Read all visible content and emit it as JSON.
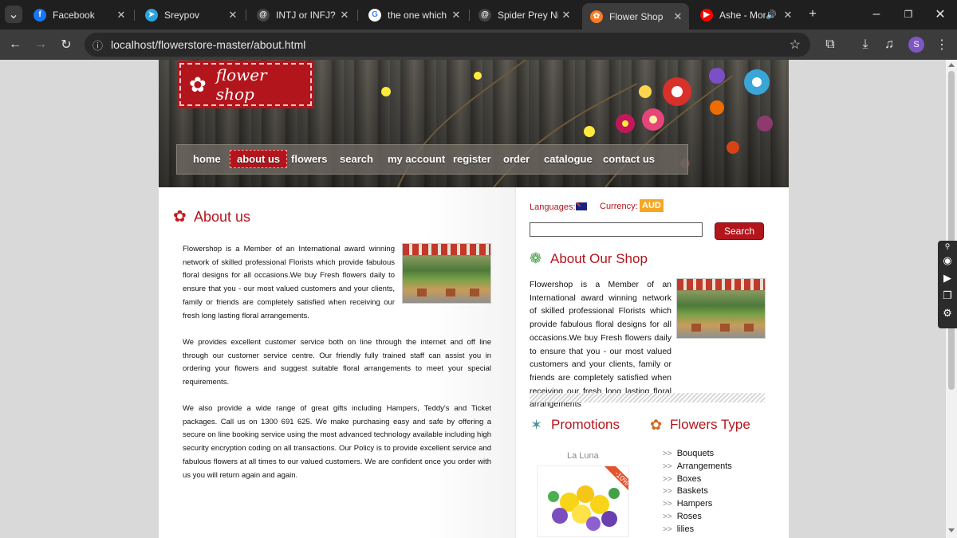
{
  "browser": {
    "tabs": [
      {
        "label": "Facebook",
        "icon": "facebook-icon",
        "color": "#1877f2",
        "glyph": "f",
        "active": false
      },
      {
        "label": "Sreypov",
        "icon": "telegram-icon",
        "color": "#2aa3df",
        "glyph": "➤",
        "active": false
      },
      {
        "label": "INTJ or INFJ?",
        "icon": "threads-icon",
        "color": "#444444",
        "glyph": "@",
        "active": false
      },
      {
        "label": "the one which co",
        "icon": "google-icon",
        "color": "#ffffff",
        "glyph": "G",
        "active": false
      },
      {
        "label": "Spider Prey Nick",
        "icon": "threads-icon",
        "color": "#444444",
        "glyph": "@",
        "active": false
      },
      {
        "label": "Flower Shop",
        "icon": "xampp-icon",
        "color": "#fb7a24",
        "glyph": "✿",
        "active": true
      },
      {
        "label": "Ashe - Mora",
        "icon": "youtube-icon",
        "color": "#ff0000",
        "glyph": "▶",
        "active": false
      }
    ],
    "url": "localhost/flowerstore-master/about.html",
    "profile_initial": "S"
  },
  "site": {
    "logo_text": "flower shop",
    "menu": [
      "home",
      "about us",
      "flowers",
      "search",
      "my account",
      "register",
      "order",
      "catalogue",
      "contact us"
    ],
    "active_menu": "about us",
    "about": {
      "title": "About us",
      "p1": "Flowershop is a Member of an International award winning network of skilled professional Florists which provide fabulous floral designs for all occasions.We buy Fresh flowers daily to ensure that you - our most valued customers and your clients, family or friends are completely satisfied when receiving our fresh long lasting floral arrangements.",
      "p2": "We provides excellent customer service both on line through the internet and off line through our customer service centre. Our friendly fully trained staff can assist you in ordering your flowers and suggest suitable floral arrangements to meet your special requirements.",
      "p3": "We also provide a wide range of great gifts including Hampers, Teddy's and Ticket packages. Call us on 1300 691 625. We make purchasing easy and safe by offering a secure on line booking service using the most advanced technology available including high security encryption coding on all transactions. Our Policy is to provide excellent service and fabulous flowers at all times to our valued customers. We are confident once you order with us you will return again and again."
    },
    "sidebar": {
      "languages_label": "Languages:",
      "currency_label": "Currency:",
      "currency_value": "AUD",
      "search_placeholder": "",
      "search_button": "Search",
      "about_shop_title": "About Our Shop",
      "about_shop_text": "Flowershop is a Member of an International award winning network of skilled professional Florists which provide fabulous floral designs for all occasions.We buy Fresh flowers daily to ensure that you - our most valued customers and your clients, family or friends are completely satisfied when receiving our fresh long lasting floral arrangements",
      "promotions_title": "Promotions",
      "promo_name": "La Luna",
      "promo_badge": "-10%",
      "flowers_type_title": "Flowers Type",
      "flower_types": [
        "Bouquets",
        "Arrangements",
        "Boxes",
        "Baskets",
        "Hampers",
        "Roses",
        "lilies"
      ]
    },
    "colors": {
      "accent": "#b3151c",
      "currency_bg": "#f5a623"
    }
  }
}
